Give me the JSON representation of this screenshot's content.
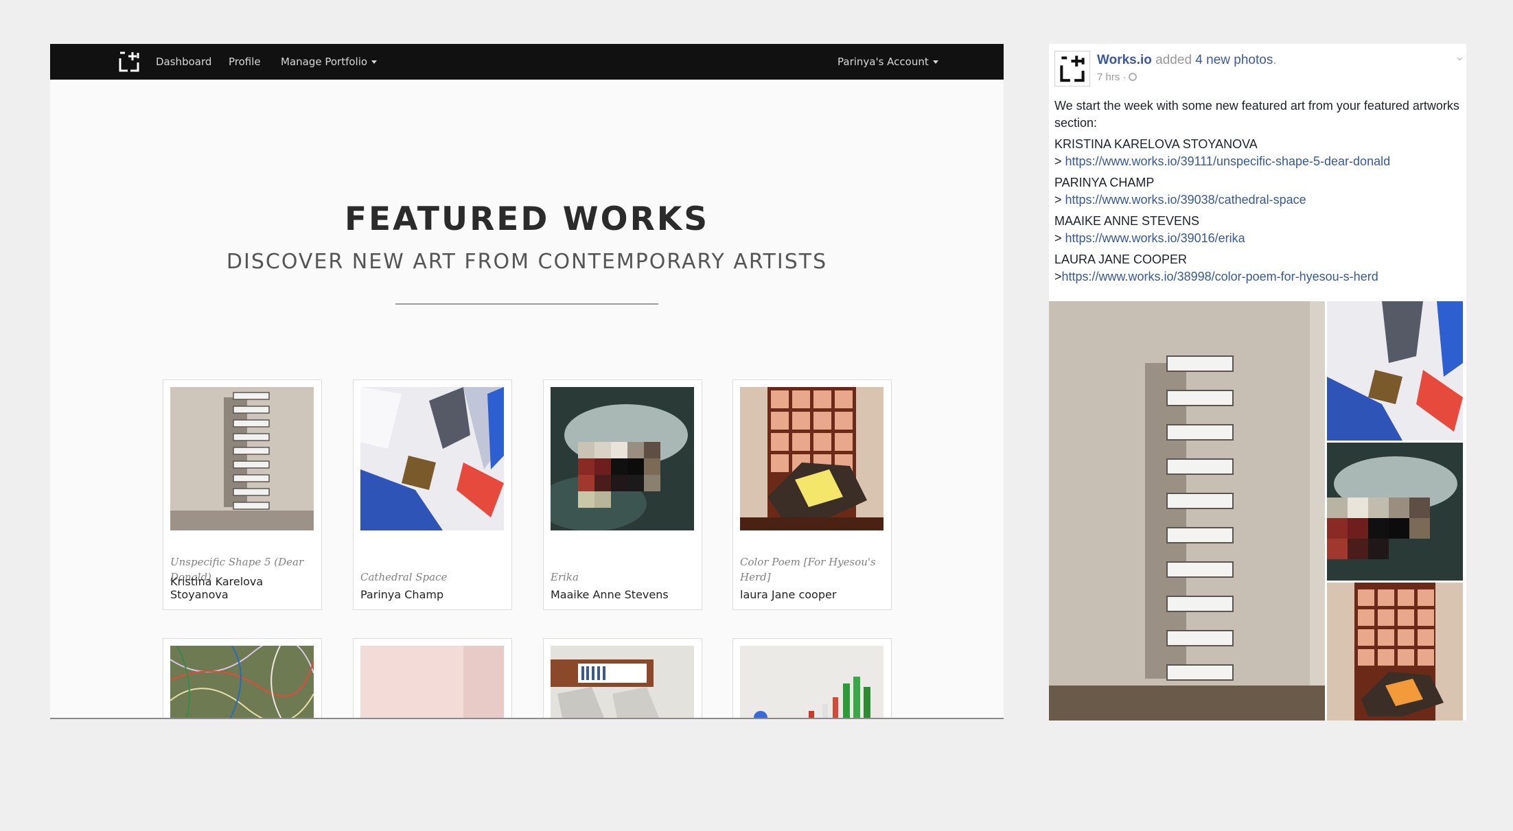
{
  "site": {
    "nav": {
      "logo_icon": "works-io-logo-icon",
      "items": [
        "Dashboard",
        "Profile",
        "Manage Portfolio"
      ],
      "account": "Parinya's Account"
    },
    "hero": {
      "title": "FEATURED WORKS",
      "subtitle": "DISCOVER NEW ART FROM CONTEMPORARY ARTISTS"
    },
    "works": [
      {
        "title": "Unspecific Shape 5 (Dear Donald)",
        "artist": "Kristina Karelova Stoyanova"
      },
      {
        "title": "Cathedral Space",
        "artist": "Parinya Champ"
      },
      {
        "title": "Erika",
        "artist": "Maaike Anne Stevens"
      },
      {
        "title": "Color Poem [For Hyesou's Herd]",
        "artist": "laura Jane cooper"
      }
    ]
  },
  "post": {
    "page_name": "Works.io",
    "action": "added",
    "action_link": "4 new photos",
    "time": "7 hrs ·",
    "intro": "We start the week with some new featured art from your featured artworks section:",
    "entries": [
      {
        "name": "KRISTINA KARELOVA STOYANOVA",
        "prefix": "> ",
        "url": "https://www.works.io/39111/unspecific-shape-5-dear-donald"
      },
      {
        "name": "PARINYA CHAMP",
        "prefix": "> ",
        "url": "https://www.works.io/39038/cathedral-space"
      },
      {
        "name": "MAAIKE ANNE STEVENS",
        "prefix": "> ",
        "url": "https://www.works.io/39016/erika"
      },
      {
        "name": "LAURA JANE COOPER",
        "prefix": ">",
        "url": "https://www.works.io/38998/color-poem-for-hyesou-s-herd"
      }
    ]
  },
  "colors": {
    "navbar": "#111111",
    "page_bg": "#efefef",
    "link_blue": "#365899"
  }
}
